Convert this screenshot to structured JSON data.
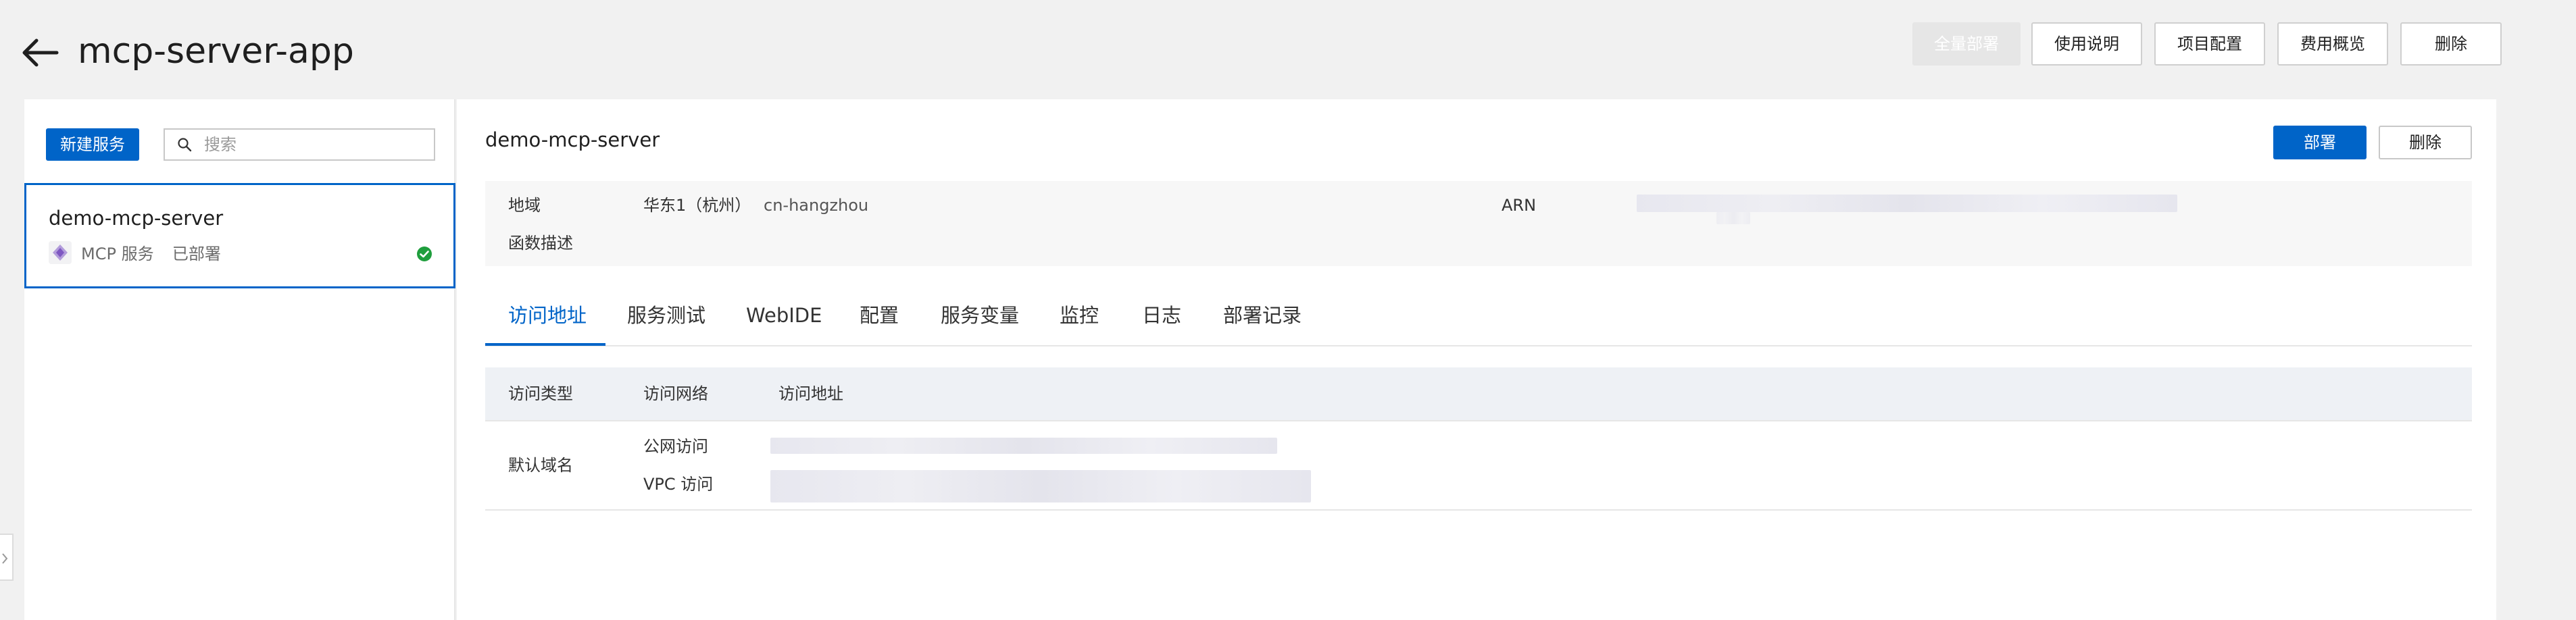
{
  "header": {
    "title": "mcp-server-app",
    "buttons": {
      "deploy_all": "全量部署",
      "usage_guide": "使用说明",
      "project_config": "项目配置",
      "cost_overview": "费用概览",
      "delete": "删除"
    }
  },
  "sidebar": {
    "new_service": "新建服务",
    "search": {
      "placeholder": "搜索",
      "value": ""
    },
    "services": [
      {
        "name": "demo-mcp-server",
        "type": "MCP 服务",
        "status": "已部署"
      }
    ]
  },
  "detail": {
    "title": "demo-mcp-server",
    "deploy": "部署",
    "delete": "删除",
    "info": {
      "region_label": "地域",
      "region_value": "华东1（杭州）",
      "region_code": "cn-hangzhou",
      "arn_label": "ARN",
      "desc_label": "函数描述"
    },
    "tabs": [
      "访问地址",
      "服务测试",
      "WebIDE",
      "配置",
      "服务变量",
      "监控",
      "日志",
      "部署记录"
    ],
    "active_tab": 0,
    "table": {
      "headers": [
        "访问类型",
        "访问网络",
        "访问地址"
      ],
      "row": {
        "type": "默认域名",
        "networks": [
          "公网访问",
          "VPC 访问"
        ]
      }
    }
  },
  "colors": {
    "primary": "#0064c8",
    "success": "#1f9e3d",
    "background": "#f1f1f1"
  }
}
